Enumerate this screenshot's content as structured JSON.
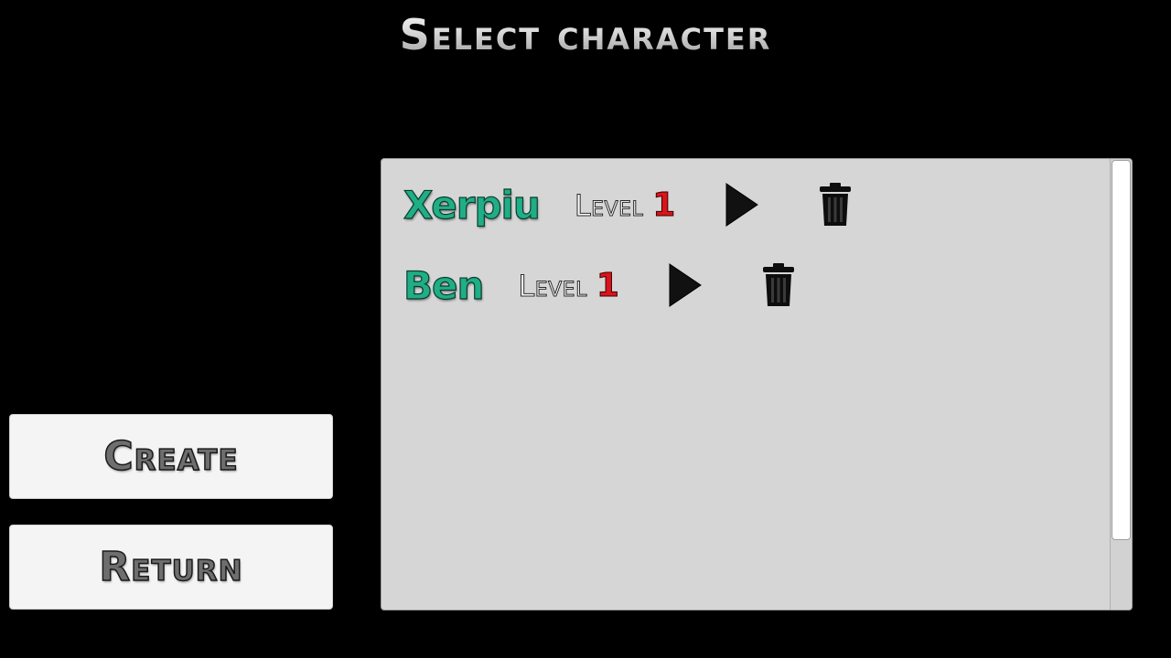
{
  "title": "Select character",
  "menu": {
    "create_label": "Create",
    "return_label": "Return"
  },
  "characters": [
    {
      "name": "Xerpiu",
      "level_label": "Level",
      "level": "1"
    },
    {
      "name": "Ben",
      "level_label": "Level",
      "level": "1"
    }
  ],
  "icons": {
    "play": "play-icon",
    "delete": "trash-icon"
  },
  "colors": {
    "background": "#000000",
    "panel": "#d6d6d6",
    "name": "#1fae86",
    "level_number": "#d9141b"
  }
}
